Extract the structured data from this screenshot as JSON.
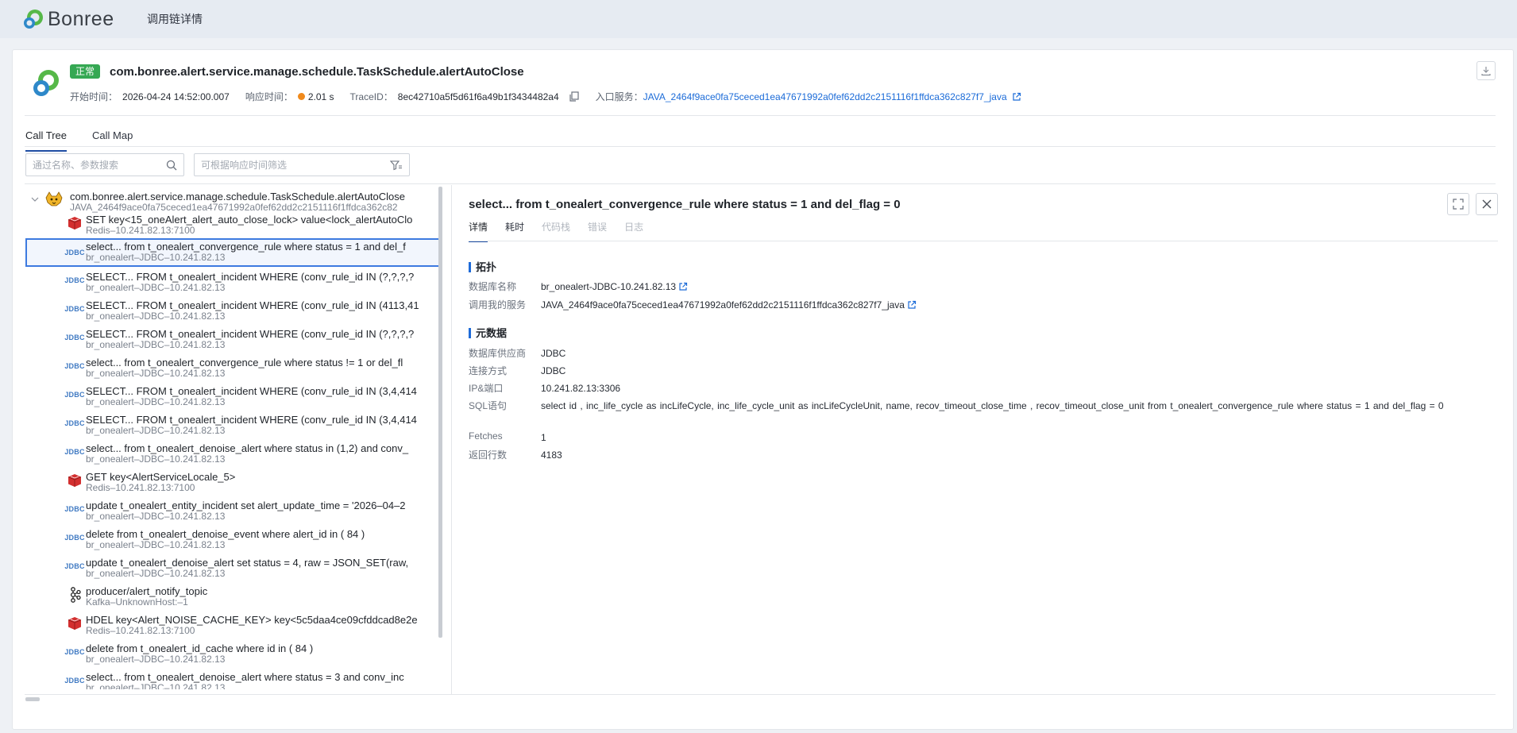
{
  "header": {
    "logo_text": "Bonree",
    "title": "调用链详情"
  },
  "summary": {
    "status": "正常",
    "title": "com.bonree.alert.service.manage.schedule.TaskSchedule.alertAutoClose",
    "start_label": "开始时间：",
    "start_value": "2026-04-24 14:52:00.007",
    "resp_label": "响应时间：",
    "resp_value": "2.01 s",
    "trace_label": "TraceID：",
    "trace_value": "8ec42710a5f5d61f6a49b1f3434482a4",
    "entry_label": "入口服务：",
    "entry_value": "JAVA_2464f9ace0fa75ceced1ea47671992a0fef62dd2c2151116f1ffdca362c827f7_java"
  },
  "tabs": [
    "Call Tree",
    "Call Map"
  ],
  "search": {
    "placeholder": "通过名称、参数搜索"
  },
  "filter": {
    "placeholder": "可根据响应时间筛选"
  },
  "tree": {
    "root": {
      "title": "com.bonree.alert.service.manage.schedule.TaskSchedule.alertAutoClose",
      "sub": "JAVA_2464f9ace0fa75ceced1ea47671992a0fef62dd2c2151116f1ffdca362c82"
    },
    "rows": [
      {
        "type": "redis",
        "title": "SET key<15_oneAlert_alert_auto_close_lock> value<lock_alertAutoClo",
        "sub": "Redis–10.241.82.13:7100"
      },
      {
        "type": "jdbc",
        "title": "select... from t_onealert_convergence_rule where status = 1 and del_f",
        "sub": "br_onealert–JDBC–10.241.82.13"
      },
      {
        "type": "jdbc",
        "title": "SELECT... FROM t_onealert_incident WHERE (conv_rule_id IN (?,?,?,?",
        "sub": "br_onealert–JDBC–10.241.82.13"
      },
      {
        "type": "jdbc",
        "title": "SELECT... FROM t_onealert_incident WHERE (conv_rule_id IN (4113,41",
        "sub": "br_onealert–JDBC–10.241.82.13"
      },
      {
        "type": "jdbc",
        "title": "SELECT... FROM t_onealert_incident WHERE (conv_rule_id IN (?,?,?,?",
        "sub": "br_onealert–JDBC–10.241.82.13"
      },
      {
        "type": "jdbc",
        "title": "select... from t_onealert_convergence_rule where status != 1 or del_fl",
        "sub": "br_onealert–JDBC–10.241.82.13"
      },
      {
        "type": "jdbc",
        "title": "SELECT... FROM t_onealert_incident WHERE (conv_rule_id IN (3,4,414",
        "sub": "br_onealert–JDBC–10.241.82.13"
      },
      {
        "type": "jdbc",
        "title": "SELECT... FROM t_onealert_incident WHERE (conv_rule_id IN (3,4,414",
        "sub": "br_onealert–JDBC–10.241.82.13"
      },
      {
        "type": "jdbc",
        "title": "select... from t_onealert_denoise_alert where status in (1,2) and conv_",
        "sub": "br_onealert–JDBC–10.241.82.13"
      },
      {
        "type": "redis",
        "title": "GET key<AlertServiceLocale_5>",
        "sub": "Redis–10.241.82.13:7100"
      },
      {
        "type": "jdbc",
        "title": "update t_onealert_entity_incident set alert_update_time = '2026–04–2",
        "sub": "br_onealert–JDBC–10.241.82.13"
      },
      {
        "type": "jdbc",
        "title": "delete from t_onealert_denoise_event where alert_id in ( 84 )",
        "sub": "br_onealert–JDBC–10.241.82.13"
      },
      {
        "type": "jdbc",
        "title": "update t_onealert_denoise_alert set status = 4, raw = JSON_SET(raw,",
        "sub": "br_onealert–JDBC–10.241.82.13"
      },
      {
        "type": "kafka",
        "title": "producer/alert_notify_topic",
        "sub": "Kafka–UnknownHost:–1"
      },
      {
        "type": "redis",
        "title": "HDEL key<Alert_NOISE_CACHE_KEY> key<5c5daa4ce09cfddcad8e2e",
        "sub": "Redis–10.241.82.13:7100"
      },
      {
        "type": "jdbc",
        "title": "delete from t_onealert_id_cache where id in ( 84 )",
        "sub": "br_onealert–JDBC–10.241.82.13"
      },
      {
        "type": "jdbc",
        "title": "select... from t_onealert_denoise_alert where status = 3 and conv_inc",
        "sub": "br_onealert–JDBC–10.241.82.13"
      }
    ],
    "jdbc_label": "JDBC"
  },
  "detail": {
    "title": "select... from t_onealert_convergence_rule where status = 1 and del_flag = 0",
    "tabs": [
      "详情",
      "耗时",
      "代码栈",
      "错误",
      "日志"
    ],
    "topology_heading": "拓扑",
    "db_name_label": "数据库名称",
    "db_name_value": "br_onealert-JDBC-10.241.82.13",
    "caller_label": "调用我的服务",
    "caller_value": "JAVA_2464f9ace0fa75ceced1ea47671992a0fef62dd2c2151116f1ffdca362c827f7_java",
    "meta_heading": "元数据",
    "vendor_label": "数据库供应商",
    "vendor_value": "JDBC",
    "conn_label": "连接方式",
    "conn_value": "JDBC",
    "ip_label": "IP&端口",
    "ip_value": "10.241.82.13:3306",
    "sql_label": "SQL语句",
    "sql_value": "select id , inc_life_cycle as incLifeCycle, inc_life_cycle_unit as incLifeCycleUnit, name, recov_timeout_close_time , recov_timeout_close_unit from t_onealert_convergence_rule where status = 1 and del_flag = 0",
    "fetch_label": "Fetches",
    "fetch_value": "1",
    "rows_label": "返回行数",
    "rows_value": "4183"
  }
}
